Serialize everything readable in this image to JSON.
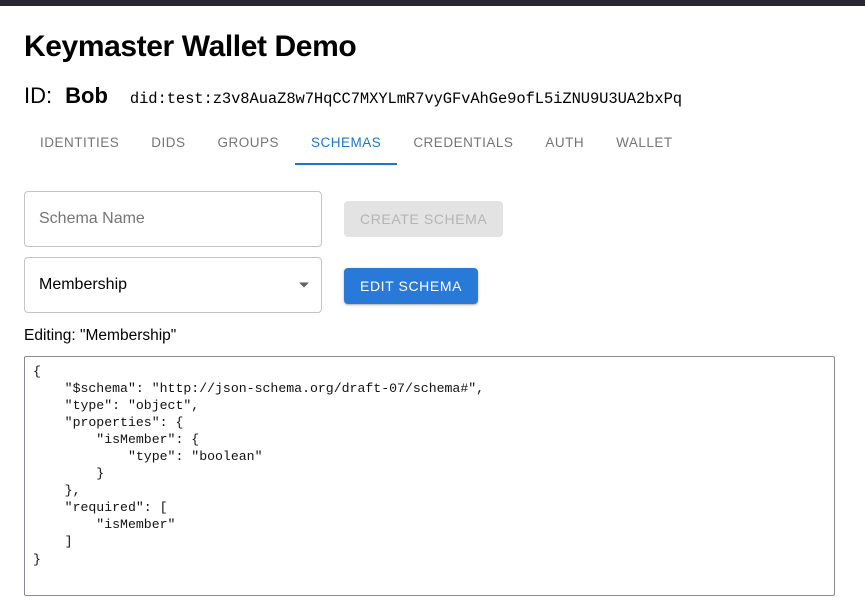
{
  "app": {
    "title": "Keymaster Wallet Demo"
  },
  "identity": {
    "label": "ID:",
    "name": "Bob",
    "did": "did:test:z3v8AuaZ8w7HqCC7MXYLmR7vyGFvAhGe9ofL5iZNU9U3UA2bxPq"
  },
  "tabs": [
    {
      "label": "IDENTITIES",
      "active": false
    },
    {
      "label": "DIDS",
      "active": false
    },
    {
      "label": "GROUPS",
      "active": false
    },
    {
      "label": "SCHEMAS",
      "active": true
    },
    {
      "label": "CREDENTIALS",
      "active": false
    },
    {
      "label": "AUTH",
      "active": false
    },
    {
      "label": "WALLET",
      "active": false
    }
  ],
  "schemas_panel": {
    "schema_name_input": {
      "placeholder": "Schema Name",
      "value": ""
    },
    "create_button": {
      "label": "CREATE SCHEMA",
      "disabled": true
    },
    "schema_select": {
      "value": "Membership"
    },
    "edit_button": {
      "label": "EDIT SCHEMA",
      "disabled": false
    },
    "editing_label": "Editing: \"Membership\"",
    "editor_value": "{\n    \"$schema\": \"http://json-schema.org/draft-07/schema#\",\n    \"type\": \"object\",\n    \"properties\": {\n        \"isMember\": {\n            \"type\": \"boolean\"\n        }\n    },\n    \"required\": [\n        \"isMember\"\n    ]\n}"
  },
  "colors": {
    "accent": "#1976d2",
    "primary_button": "#2979d8",
    "top_bar": "#282733",
    "disabled_text": "#b4b4b4"
  }
}
